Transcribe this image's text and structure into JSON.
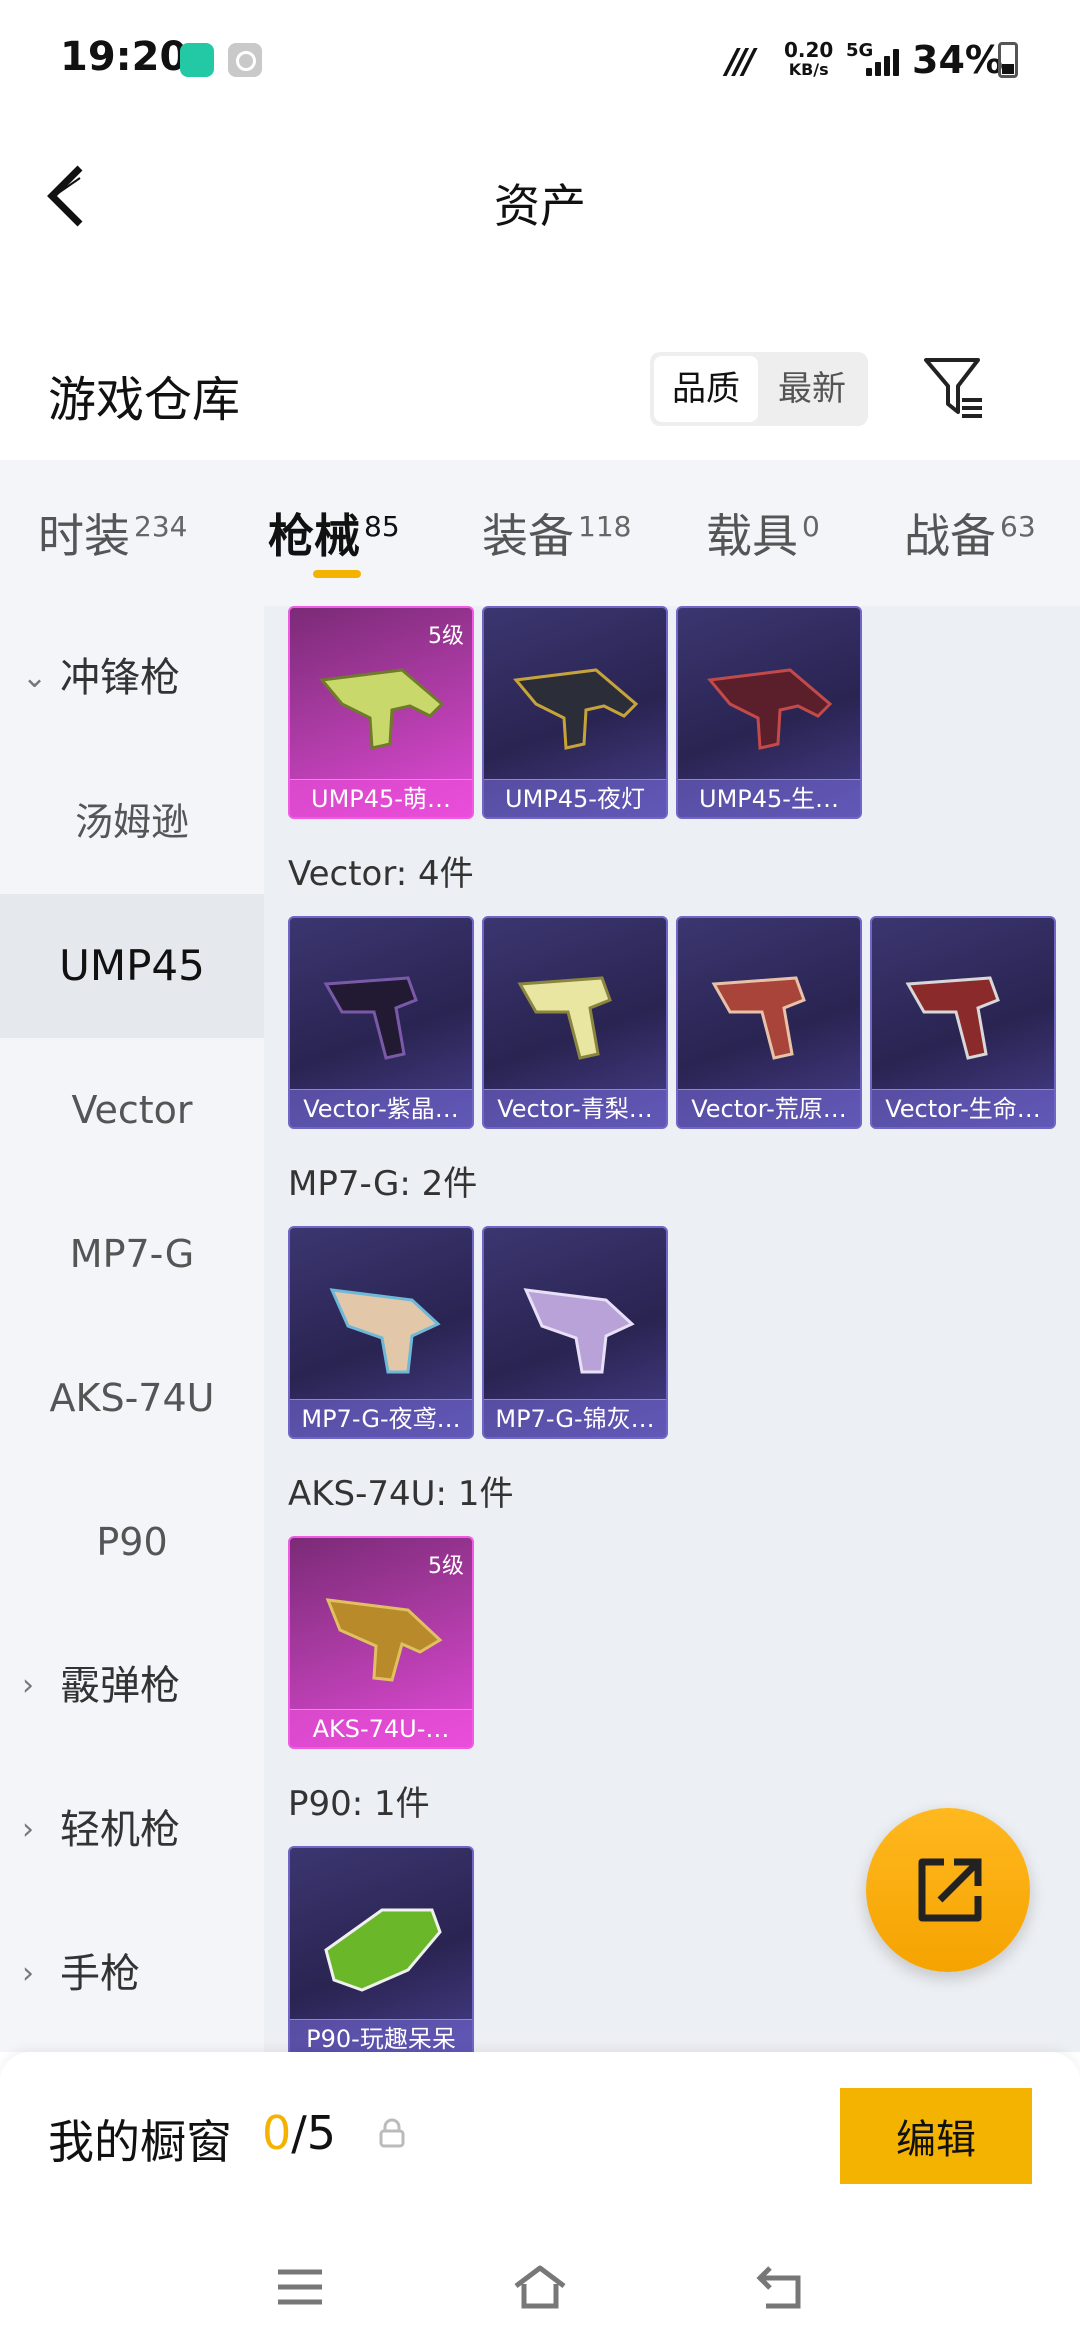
{
  "status_bar": {
    "time": "19:20",
    "net_speed_value": "0.20",
    "net_speed_unit": "KB/s",
    "network": "5G",
    "battery": "34%"
  },
  "header": {
    "title": "资产"
  },
  "warehouse": {
    "title": "游戏仓库",
    "sort_options": [
      "品质",
      "最新"
    ],
    "selected_sort": "品质"
  },
  "tabs": [
    {
      "label": "时装",
      "count": "234"
    },
    {
      "label": "枪械",
      "count": "85"
    },
    {
      "label": "装备",
      "count": "118"
    },
    {
      "label": "载具",
      "count": "0"
    },
    {
      "label": "战备",
      "count": "63"
    }
  ],
  "active_tab": "枪械",
  "sidebar": [
    {
      "label": "冲锋枪",
      "type": "category",
      "expanded": true
    },
    {
      "label": "汤姆逊",
      "type": "sub"
    },
    {
      "label": "UMP45",
      "type": "sub",
      "selected": true
    },
    {
      "label": "Vector",
      "type": "sub"
    },
    {
      "label": "MP7-G",
      "type": "sub"
    },
    {
      "label": "AKS-74U",
      "type": "sub"
    },
    {
      "label": "P90",
      "type": "sub"
    },
    {
      "label": "霰弹枪",
      "type": "category"
    },
    {
      "label": "轻机枪",
      "type": "category"
    },
    {
      "label": "手枪",
      "type": "category"
    }
  ],
  "groups": [
    {
      "title": "",
      "items": [
        {
          "name": "UMP45-萌…",
          "rarity": "pink",
          "level": "5级"
        },
        {
          "name": "UMP45-夜灯",
          "rarity": "purple"
        },
        {
          "name": "UMP45-生…",
          "rarity": "purple"
        }
      ]
    },
    {
      "title": "Vector: 4件",
      "items": [
        {
          "name": "Vector-紫晶…",
          "rarity": "purple"
        },
        {
          "name": "Vector-青梨…",
          "rarity": "purple"
        },
        {
          "name": "Vector-荒原…",
          "rarity": "purple"
        },
        {
          "name": "Vector-生命…",
          "rarity": "purple"
        }
      ]
    },
    {
      "title": "MP7-G: 2件",
      "items": [
        {
          "name": "MP7-G-夜鸢…",
          "rarity": "purple"
        },
        {
          "name": "MP7-G-锦灰…",
          "rarity": "purple"
        }
      ]
    },
    {
      "title": "AKS-74U: 1件",
      "items": [
        {
          "name": "AKS-74U-…",
          "rarity": "pink",
          "level": "5级"
        }
      ]
    },
    {
      "title": "P90: 1件",
      "items": [
        {
          "name": "P90-玩趣呆呆",
          "rarity": "purple"
        }
      ]
    }
  ],
  "showcase": {
    "title": "我的橱窗",
    "current": "0",
    "total": "/5",
    "edit_label": "编辑"
  },
  "colors": {
    "accent": "#f5b301",
    "purple_card": "#2a2452",
    "pink_card": "#e24ad8",
    "sidebar_bg": "#f3f5f9",
    "grid_bg": "#eceff3"
  }
}
